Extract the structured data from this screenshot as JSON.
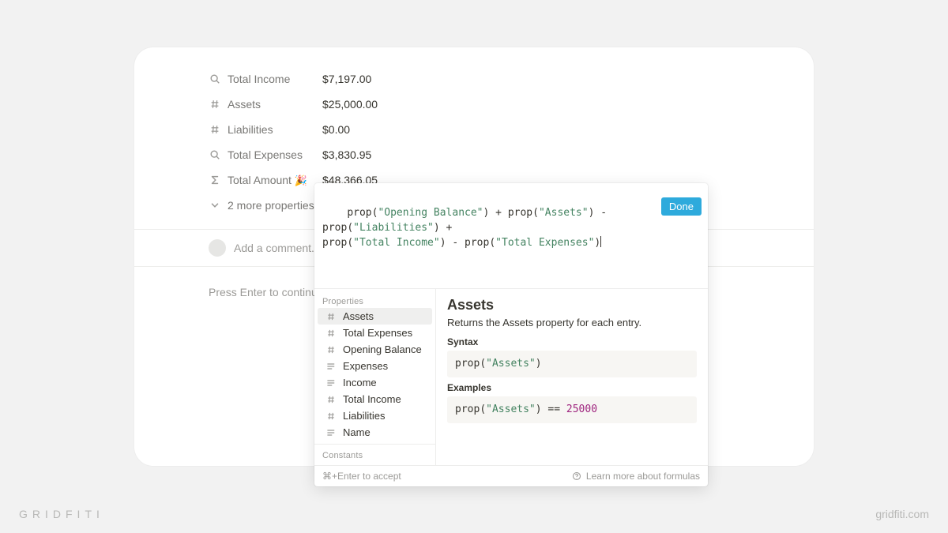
{
  "properties": [
    {
      "icon": "search",
      "label": "Total Income",
      "value": "$7,197.00"
    },
    {
      "icon": "hash",
      "label": "Assets",
      "value": "$25,000.00"
    },
    {
      "icon": "hash",
      "label": "Liabilities",
      "value": "$0.00"
    },
    {
      "icon": "search",
      "label": "Total Expenses",
      "value": "$3,830.95"
    },
    {
      "icon": "sigma",
      "label": "Total Amount",
      "emoji": "🎉",
      "value": "$48,366.05"
    }
  ],
  "more_properties": "2 more properties",
  "comment_placeholder": "Add a comment...",
  "body_hint": "Press Enter to continu",
  "formula": {
    "done": "Done",
    "tokens": [
      {
        "t": "fn",
        "v": "prop"
      },
      {
        "t": "plain",
        "v": "("
      },
      {
        "t": "str",
        "v": "\"Opening Balance\""
      },
      {
        "t": "plain",
        "v": ") + "
      },
      {
        "t": "fn",
        "v": "prop"
      },
      {
        "t": "plain",
        "v": "("
      },
      {
        "t": "str",
        "v": "\"Assets\""
      },
      {
        "t": "plain",
        "v": ") - "
      },
      {
        "t": "fn",
        "v": "prop"
      },
      {
        "t": "plain",
        "v": "("
      },
      {
        "t": "str",
        "v": "\"Liabilities\""
      },
      {
        "t": "plain",
        "v": ") + "
      },
      {
        "t": "br"
      },
      {
        "t": "fn",
        "v": "prop"
      },
      {
        "t": "plain",
        "v": "("
      },
      {
        "t": "str",
        "v": "\"Total Income\""
      },
      {
        "t": "plain",
        "v": ") - "
      },
      {
        "t": "fn",
        "v": "prop"
      },
      {
        "t": "plain",
        "v": "("
      },
      {
        "t": "str",
        "v": "\"Total Expenses\""
      },
      {
        "t": "plain",
        "v": ")"
      },
      {
        "t": "caret"
      }
    ],
    "section_properties": "Properties",
    "section_constants": "Constants",
    "suggestions": [
      {
        "icon": "hash",
        "label": "Assets",
        "selected": true
      },
      {
        "icon": "hash",
        "label": "Total Expenses"
      },
      {
        "icon": "hash",
        "label": "Opening Balance"
      },
      {
        "icon": "lines",
        "label": "Expenses"
      },
      {
        "icon": "lines",
        "label": "Income"
      },
      {
        "icon": "hash",
        "label": "Total Income"
      },
      {
        "icon": "hash",
        "label": "Liabilities"
      },
      {
        "icon": "lines",
        "label": "Name"
      }
    ],
    "detail": {
      "title": "Assets",
      "description": "Returns the Assets property for each entry.",
      "syntax_label": "Syntax",
      "syntax_tokens": [
        {
          "t": "fn",
          "v": "prop"
        },
        {
          "t": "plain",
          "v": "("
        },
        {
          "t": "str",
          "v": "\"Assets\""
        },
        {
          "t": "plain",
          "v": ")"
        }
      ],
      "examples_label": "Examples",
      "example_tokens": [
        {
          "t": "fn",
          "v": "prop"
        },
        {
          "t": "plain",
          "v": "("
        },
        {
          "t": "str",
          "v": "\"Assets\""
        },
        {
          "t": "plain",
          "v": ") == "
        },
        {
          "t": "num",
          "v": "25000"
        }
      ]
    },
    "accept_hint": "⌘+Enter to accept",
    "learn_more": "Learn more about formulas"
  },
  "brand": {
    "left": "GRIDFITI",
    "right": "gridfiti.com"
  }
}
